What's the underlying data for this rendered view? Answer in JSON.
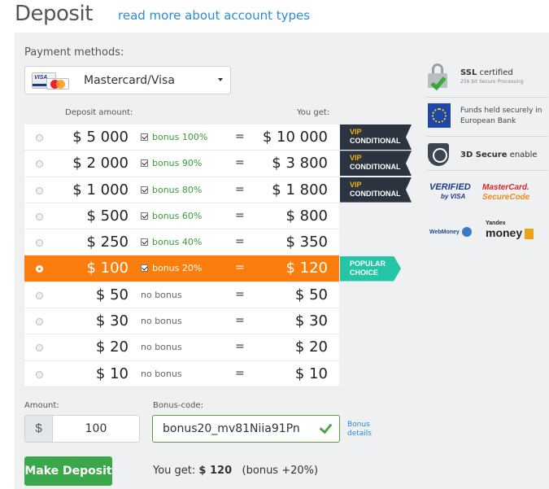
{
  "header": {
    "title": "Deposit",
    "link": "read more about account types"
  },
  "payment": {
    "label": "Payment methods:",
    "selected": "Mastercard/Visa",
    "card_icons": [
      "visa-icon",
      "mastercard-icon"
    ]
  },
  "table": {
    "col_amount": "Deposit amount:",
    "col_get": "You get:",
    "rows": [
      {
        "amount": "$ 5 000",
        "bonus": "bonus 100%",
        "bonus_checked": true,
        "eq": "=",
        "get": "$ 10 000",
        "tag": [
          "VIP",
          "CONDITIONAL"
        ]
      },
      {
        "amount": "$ 2 000",
        "bonus": "bonus 90%",
        "bonus_checked": true,
        "eq": "=",
        "get": "$ 3 800",
        "tag": [
          "VIP",
          "CONDITIONAL"
        ]
      },
      {
        "amount": "$ 1 000",
        "bonus": "bonus 80%",
        "bonus_checked": true,
        "eq": "=",
        "get": "$ 1 800",
        "tag": [
          "VIP",
          "CONDITIONAL"
        ]
      },
      {
        "amount": "$ 500",
        "bonus": "bonus 60%",
        "bonus_checked": true,
        "eq": "=",
        "get": "$ 800"
      },
      {
        "amount": "$ 250",
        "bonus": "bonus 40%",
        "bonus_checked": true,
        "eq": "=",
        "get": "$ 350"
      },
      {
        "amount": "$ 100",
        "bonus": "bonus 20%",
        "bonus_checked": true,
        "eq": "=",
        "get": "$ 120",
        "selected": true,
        "tag": [
          "POPULAR",
          "CHOICE"
        ]
      },
      {
        "amount": "$ 50",
        "bonus": "no bonus",
        "bonus_checked": false,
        "eq": "=",
        "get": "$ 50"
      },
      {
        "amount": "$ 30",
        "bonus": "no bonus",
        "bonus_checked": false,
        "eq": "=",
        "get": "$ 30"
      },
      {
        "amount": "$ 20",
        "bonus": "no bonus",
        "bonus_checked": false,
        "eq": "=",
        "get": "$ 20"
      },
      {
        "amount": "$ 10",
        "bonus": "no bonus",
        "bonus_checked": false,
        "eq": "=",
        "get": "$ 10"
      }
    ]
  },
  "side": {
    "ssl_title_bold": "SSL",
    "ssl_title_rest": "certified",
    "ssl_sub": "256 bit Secure Processing",
    "eu_text": "Funds held securely in European Bank",
    "secure_bold": "3D Secure",
    "secure_rest": "enable",
    "verified_visa": [
      "VERIFIED",
      "by VISA"
    ],
    "mastercard_securecode": [
      "MasterCard.",
      "SecureCode"
    ],
    "webmoney": "WebMoney",
    "yandex": [
      "Yandex",
      "money"
    ]
  },
  "form": {
    "amount_label": "Amount:",
    "currency": "$",
    "amount_value": "100",
    "bonus_label": "Bonus-code:",
    "bonus_value": "bonus20_mv81Niia91Pn",
    "bonus_details": "Bonus details",
    "submit": "Make Deposit",
    "you_get_label": "You get:",
    "you_get_value": "$ 120",
    "you_get_note": "(bonus +20%)"
  },
  "colors": {
    "accent_orange": "#fb7d0e",
    "vip_dark": "#2b3440",
    "vip_gold": "#f5b400",
    "popular_teal": "#23c5a4",
    "button_green": "#3aa84a",
    "link_blue": "#2b8bd3"
  }
}
